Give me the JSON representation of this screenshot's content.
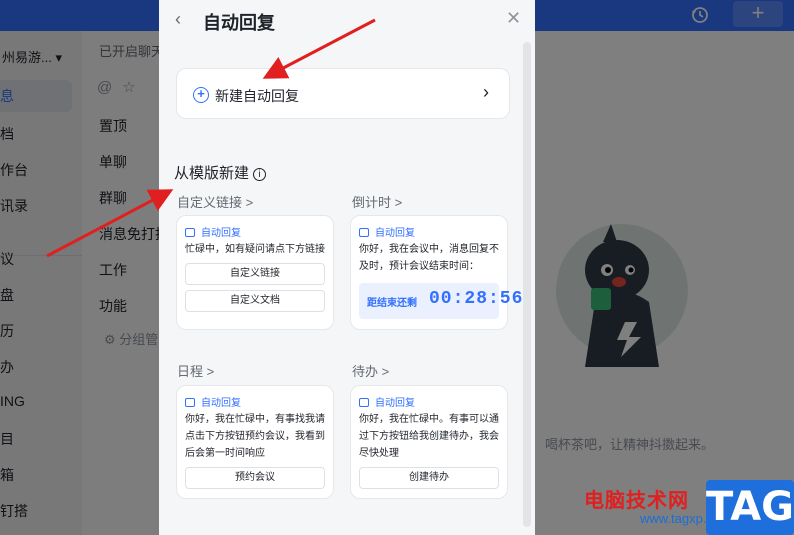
{
  "background_app": {
    "org_name": "州易游...",
    "nav_items": [
      "息",
      "档",
      "作台",
      "讯录",
      "议",
      "盘",
      "历",
      "办",
      "ING",
      "目",
      "箱",
      "钉搭"
    ],
    "status_text": "已开启聊天",
    "mid_items": [
      "置顶",
      "单聊",
      "群聊",
      "消息免打扰",
      "工作",
      "功能"
    ],
    "group_manage": "分组管",
    "empty_hint": "喝杯茶吧，让精神抖擞起来。",
    "plus_label": "+"
  },
  "panel": {
    "title": "自动回复",
    "back_glyph": "‹",
    "close_glyph": "✕",
    "create_label": "新建自动回复",
    "create_chevron": "›",
    "section_title": "从模版新建",
    "info_glyph": "i"
  },
  "templates": [
    {
      "category": "自定义链接 >",
      "header": "自动回复",
      "message": "忙碌中，如有疑问请点下方链接",
      "buttons": [
        "自定义链接",
        "自定义文档"
      ]
    },
    {
      "category": "倒计时 >",
      "header": "自动回复",
      "message": "你好，我在会议中，消息回复不及时，预计会议结束时间：",
      "countdown_label": "距结束还剩",
      "countdown_time": "00:28:56"
    },
    {
      "category": "日程 >",
      "header": "自动回复",
      "message": "你好，我在忙碌中，有事找我请点击下方按钮预约会议，我看到后会第一时间响应",
      "buttons": [
        "预约会议"
      ]
    },
    {
      "category": "待办 >",
      "header": "自动回复",
      "message": "你好，我在忙碌中。有事可以通过下方按钮给我创建待办，我会尽快处理",
      "buttons": [
        "创建待办"
      ]
    }
  ],
  "watermark": {
    "site_name": "电脑技术网",
    "url": "www.tagxp.com",
    "tag": "TAG"
  },
  "colors": {
    "accent": "#3370ff",
    "arrow": "#e02020"
  },
  "icons": [
    "history-icon",
    "plus-icon",
    "back-icon",
    "close-icon",
    "add-circle-icon",
    "chevron-right-icon",
    "info-icon",
    "message-bubble-icon",
    "mascot-illustration"
  ]
}
